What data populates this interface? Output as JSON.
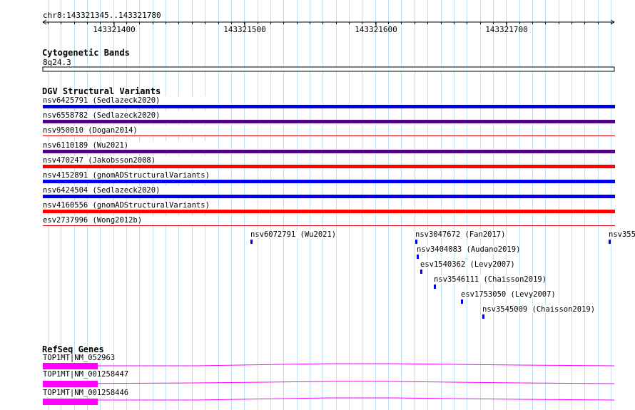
{
  "ruler": {
    "location": "chr8:143321345..143321780",
    "ticks": [
      "143321400",
      "143321500",
      "143321600",
      "143321700"
    ]
  },
  "cytoband": {
    "title": "Cytogenetic Bands",
    "band": "8q24.3"
  },
  "dgv": {
    "title": "DGV Structural Variants",
    "full_width": [
      {
        "label": "nsv6425791 (Sedlazeck2020)",
        "color": "#0000ee",
        "style": "thick"
      },
      {
        "label": "nsv6558782 (Sedlazeck2020)",
        "color": "#550088",
        "style": "thick"
      },
      {
        "label": "nsv950010 (Dogan2014)",
        "color": "#dd0000",
        "style": "thin"
      },
      {
        "label": "nsv6110189 (Wu2021)",
        "color": "#550088",
        "style": "thick"
      },
      {
        "label": "nsv470247 (Jakobsson2008)",
        "color": "#ff0000",
        "style": "thick"
      },
      {
        "label": "nsv4152891 (gnomADStructuralVariants)",
        "color": "#0000ee",
        "style": "thick"
      },
      {
        "label": "nsv6424504 (Sedlazeck2020)",
        "color": "#0000ee",
        "style": "thick"
      },
      {
        "label": "nsv4160556 (gnomADStructuralVariants)",
        "color": "#ff0000",
        "style": "thick"
      },
      {
        "label": "esv2737996 (Wong2012b)",
        "color": "#dd0000",
        "style": "thin"
      }
    ],
    "small": [
      {
        "label": "nsv6072791 (Wu2021)",
        "color": "#0000ee"
      },
      {
        "label": "nsv3047672 (Fan2017)",
        "color": "#0000ee"
      },
      {
        "label": "nsv355",
        "color": "#0000ee"
      },
      {
        "label": "nsv3404083 (Audano2019)",
        "color": "#0000ee"
      },
      {
        "label": "esv1540362 (Levy2007)",
        "color": "#0000ee"
      },
      {
        "label": "nsv3546111 (Chaisson2019)",
        "color": "#0000ee"
      },
      {
        "label": "esv1753050 (Levy2007)",
        "color": "#0000ee"
      },
      {
        "label": "nsv3545009 (Chaisson2019)",
        "color": "#0000ee"
      }
    ]
  },
  "refseq": {
    "title": "RefSeq Genes",
    "color": "#ff00ff",
    "transcripts": [
      {
        "label": "TOP1MT|NM_052963"
      },
      {
        "label": "TOP1MT|NM_001258447"
      },
      {
        "label": "TOP1MT|NM_001258446"
      }
    ]
  }
}
